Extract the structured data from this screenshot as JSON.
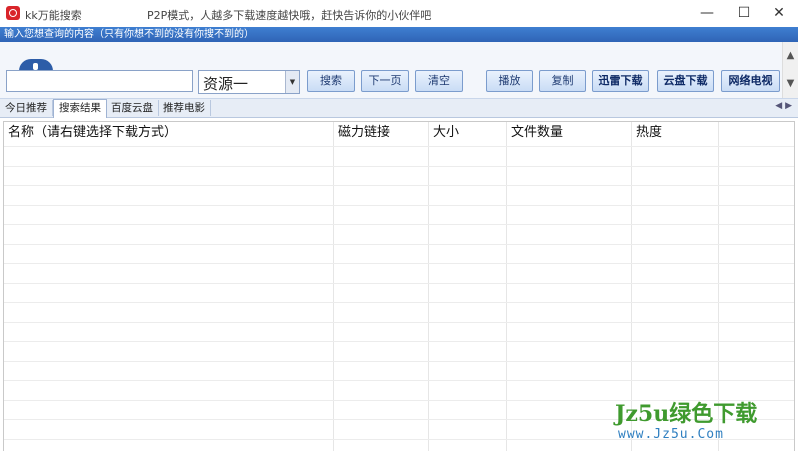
{
  "window": {
    "title": "kk万能搜索",
    "slogan": "P2P模式，人越多下载速度越快哦，赶快告诉你的小伙伴吧",
    "minimize": "—",
    "maximize": "☐",
    "close": "✕"
  },
  "hint": "输入您想查询的内容（只有你想不到的没有你搜不到的）",
  "search": {
    "value": "",
    "source_selected": "资源一",
    "dropdown_arrow": "▼"
  },
  "toolbar": {
    "search": "搜索",
    "next_page": "下一页",
    "clear": "清空",
    "play": "播放",
    "copy": "复制",
    "xunlei_download": "迅雷下载",
    "cloud_download": "云盘下载",
    "net_tv": "网络电视"
  },
  "scroll": {
    "up": "▲",
    "down": "▼"
  },
  "tabs": [
    "今日推荐",
    "搜索结果",
    "百度云盘",
    "推荐电影"
  ],
  "tab_arrows": "◀ ▶",
  "table": {
    "columns": [
      "名称（请右键选择下载方式）",
      "磁力链接",
      "大小",
      "文件数量",
      "热度"
    ]
  },
  "watermark": {
    "main": "Jz5u绿色下载",
    "sub": "www.Jz5u.Com"
  },
  "icons": [
    "app-icon",
    "globe-icon",
    "dropdown-arrow-icon",
    "scroll-up-icon",
    "scroll-down-icon"
  ]
}
